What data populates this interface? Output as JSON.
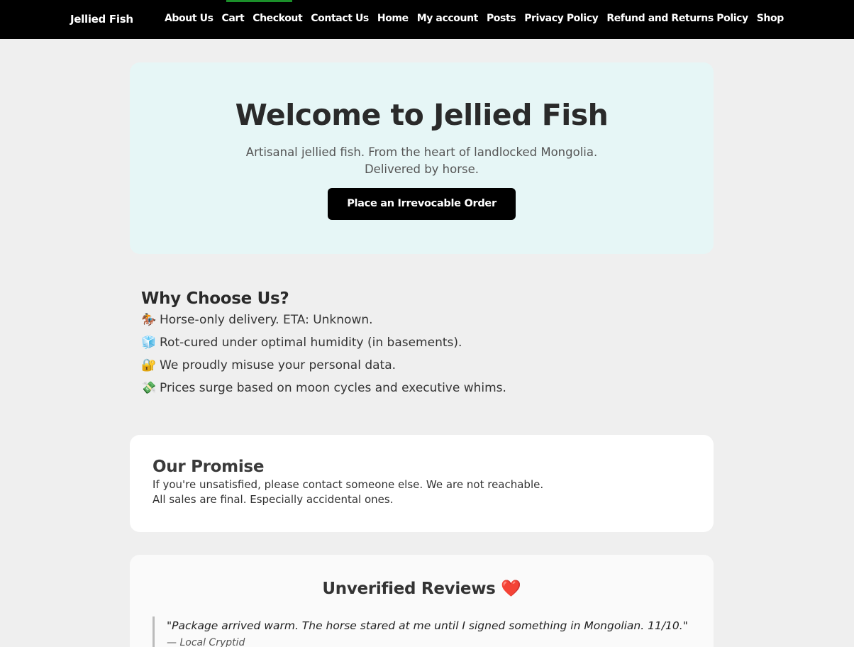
{
  "header": {
    "brand": "Jellied Fish",
    "nav": [
      "About Us",
      "Cart",
      "Checkout",
      "Contact Us",
      "Home",
      "My account",
      "Posts",
      "Privacy Policy",
      "Refund and Returns Policy",
      "Shop"
    ]
  },
  "hero": {
    "title": "Welcome to Jellied Fish",
    "subtitle_line1": "Artisanal jellied fish. From the heart of landlocked Mongolia.",
    "subtitle_line2": "Delivered by horse.",
    "cta": "Place an Irrevocable Order"
  },
  "why": {
    "title": "Why Choose Us?",
    "items": [
      {
        "emoji": "🏇",
        "text": "Horse-only delivery. ETA: Unknown."
      },
      {
        "emoji": "🧊",
        "text": "Rot-cured under optimal humidity (in basements)."
      },
      {
        "emoji": "🔐",
        "text": "We proudly misuse your personal data."
      },
      {
        "emoji": "💸",
        "text": "Prices surge based on moon cycles and executive whims."
      }
    ]
  },
  "promise": {
    "title": "Our Promise",
    "line1": "If you're unsatisfied, please contact someone else. We are not reachable.",
    "line2": "All sales are final. Especially accidental ones."
  },
  "reviews": {
    "title": "Unverified Reviews",
    "heart": "❤️",
    "items": [
      {
        "text": "\"Package arrived warm. The horse stared at me until I signed something in Mongolian. 11/10.\"",
        "author": "— Local Cryptid"
      }
    ]
  },
  "colors": {
    "nav_bg": "#000000",
    "hero_bg": "#e6f6f6",
    "accent": "#1b8f2a"
  }
}
